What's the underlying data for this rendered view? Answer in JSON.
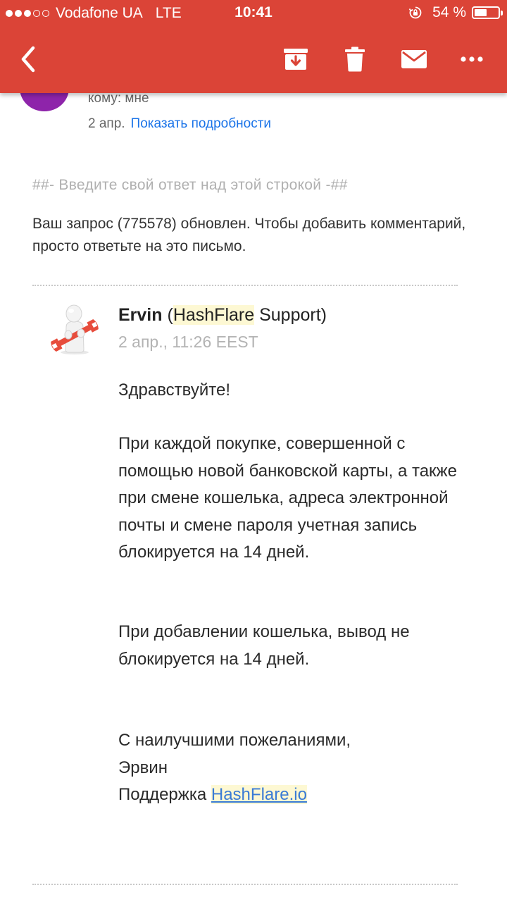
{
  "status_bar": {
    "carrier": "Vodafone UA",
    "network": "LTE",
    "time": "10:41",
    "battery_percent": "54 %",
    "battery_level": 0.54,
    "signal_bars_filled": 3,
    "signal_bars_total": 5
  },
  "toolbar": {
    "icons": [
      "back-icon",
      "archive-icon",
      "delete-icon",
      "mark-unread-icon",
      "more-icon"
    ],
    "background_color": "#db4437"
  },
  "message": {
    "avatar_color": "#8e24aa",
    "to_line": "кому: мне",
    "date": "2 апр.",
    "show_details": "Показать подробности",
    "reply_marker": "##- Введите свой ответ над этой строкой -##",
    "intro": "Ваш запрос (775578) обновлен. Чтобы добавить комментарий, просто ответьте на это письмо."
  },
  "reply": {
    "agent_first_name": "Ervin",
    "agent_paren_open": "(",
    "agent_company": "HashFlare",
    "agent_role": "Support)",
    "timestamp": "2 апр., 11:26 EEST",
    "greeting": "Здравствуйте!",
    "paragraph_1": "При каждой покупке, совершенной с помощью новой банковской карты, а также при смене кошелька, адреса электронной почты и смене пароля учетная запись блокируется на 14 дней.",
    "paragraph_2": "При добавлении кошелька, вывод не блокируется на 14 дней.",
    "sign_off": "С наилучшими пожеланиями,",
    "signature_name": "Эрвин",
    "signature_support": "Поддержка",
    "signature_link": "HashFlare.io"
  }
}
